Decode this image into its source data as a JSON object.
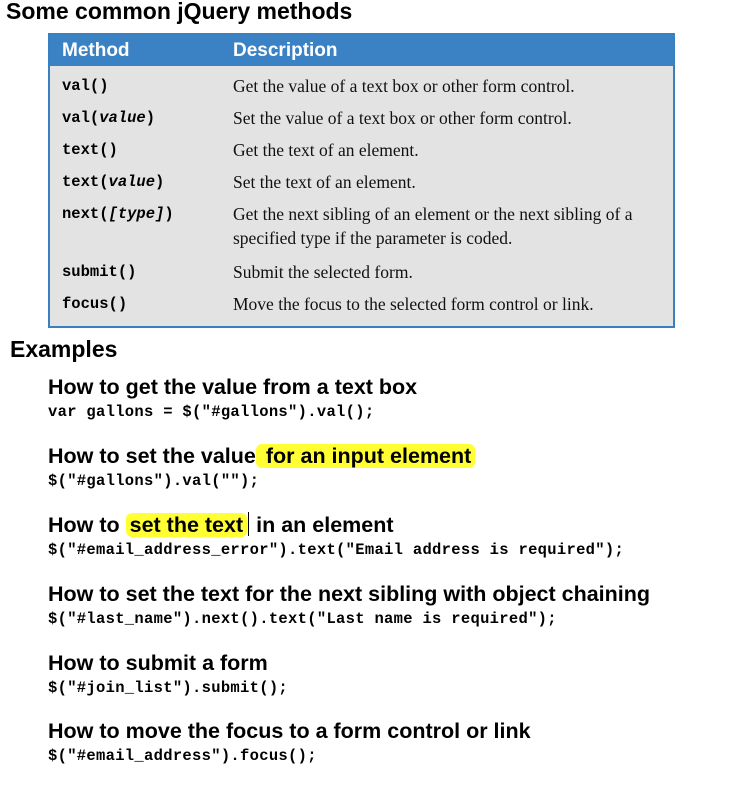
{
  "title": "Some common jQuery methods",
  "table": {
    "header": {
      "method": "Method",
      "description": "Description"
    },
    "rows": [
      {
        "name": "val",
        "param": "",
        "description": "Get the value of a text box or other form control."
      },
      {
        "name": "val",
        "param": "value",
        "description": "Set the value of a text box or other form control."
      },
      {
        "name": "text",
        "param": "",
        "description": "Get the text of an element."
      },
      {
        "name": "text",
        "param": "value",
        "description": "Set the text of an element."
      },
      {
        "name": "next",
        "param": "[type]",
        "description": "Get the next sibling of an element or the next sibling of a specified type if the parameter is coded."
      },
      {
        "name": "submit",
        "param": "",
        "description": "Submit the selected form."
      },
      {
        "name": "focus",
        "param": "",
        "description": "Move the focus to the selected form control or link."
      }
    ]
  },
  "examples_title": "Examples",
  "examples": [
    {
      "heading": "How to get the value from a text box",
      "code": "var gallons = $(\"#gallons\").val();"
    },
    {
      "heading_before": "How to set the value",
      "heading_highlight": " for an input element",
      "code": "$(\"#gallons\").val(\"\");"
    },
    {
      "heading_before": "How to ",
      "heading_highlight": "set the text",
      "heading_after": " in an element",
      "code": "$(\"#email_address_error\").text(\"Email address is required\");"
    },
    {
      "heading": "How to set the text for the next sibling with object chaining",
      "code": "$(\"#last_name\").next().text(\"Last name is required\");"
    },
    {
      "heading": "How to submit a form",
      "code": "$(\"#join_list\").submit();"
    },
    {
      "heading": "How to move the focus to a form control or link",
      "code": "$(\"#email_address\").focus();"
    }
  ],
  "colors": {
    "header_bg": "#3b82c4",
    "table_bg": "#e3e3e3",
    "highlight": "#ffff33"
  }
}
